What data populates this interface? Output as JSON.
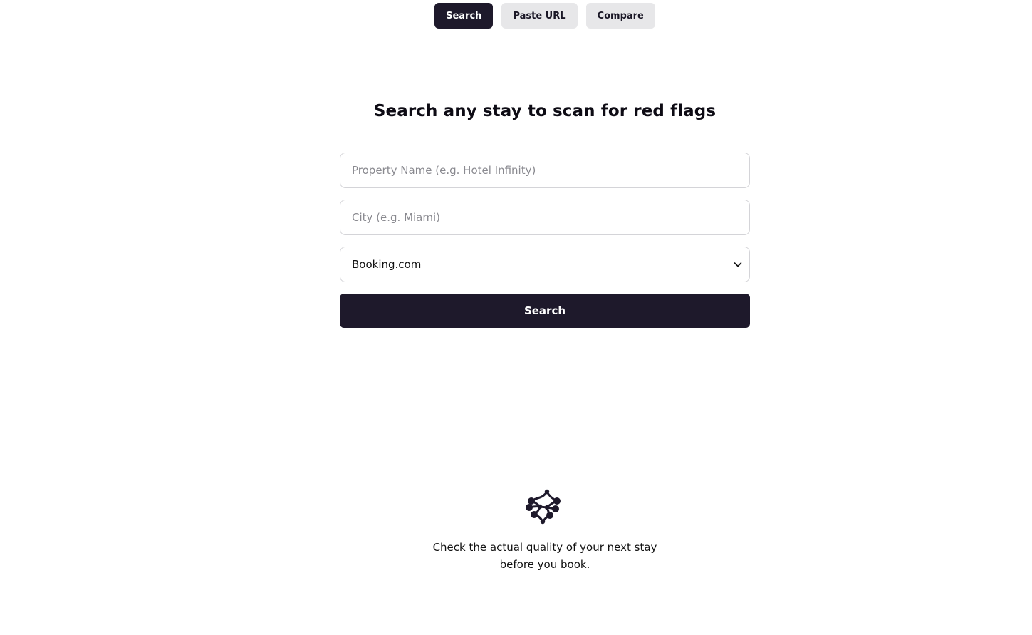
{
  "tabs": [
    {
      "label": "Search",
      "active": true
    },
    {
      "label": "Paste URL",
      "active": false
    },
    {
      "label": "Compare",
      "active": false
    }
  ],
  "main": {
    "title": "Search any stay to scan for red flags",
    "property_name": {
      "value": "",
      "placeholder": "Property Name (e.g. Hotel Infinity)"
    },
    "city": {
      "value": "",
      "placeholder": "City (e.g. Miami)"
    },
    "platform": {
      "selected": "Booking.com"
    },
    "search_button": "Search"
  },
  "footer": {
    "logo_icon": "molecule-logo-icon",
    "tagline_line1": "Check the actual quality of your next stay",
    "tagline_line2": "before you book."
  },
  "colors": {
    "primary": "#1e192b",
    "secondary_tab_bg": "#e7e7e9",
    "border": "#d4d4d8",
    "placeholder": "#8a8a90"
  }
}
